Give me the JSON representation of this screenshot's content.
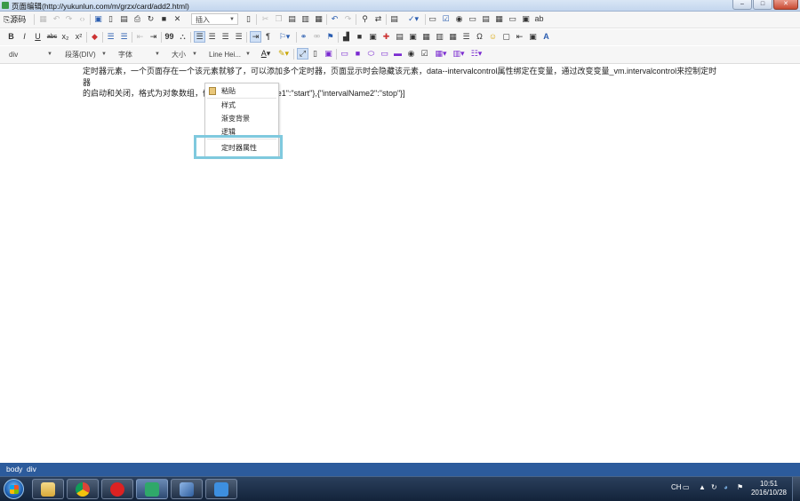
{
  "window": {
    "title": "页面编辑(http://yukunlun.com/m/grzx/card/add2.html)",
    "controls": [
      "–",
      "□",
      "✕"
    ]
  },
  "toolbar": {
    "source_label": "源码",
    "insert_label": "插入",
    "row2_glyphs": {
      "bold": "B",
      "italic": "I",
      "underline": "U",
      "strike": "abc",
      "subscript": "x₂",
      "superscript": "x²",
      "quote": "99",
      "special_char": "Ω"
    },
    "font_tag": "div",
    "paragraph_format": "段落(DIV)",
    "font_family": "字体",
    "font_size": "大小",
    "line_height": "Line Hei..."
  },
  "content": {
    "text_line1": "定时器元素，一个页面存在一个该元素就够了，可以添加多个定时器，页面显示时会隐藏该元素，data--intervalcontrol属性绑定在变量，通过改变变量_vm.intervalcontrol来控制定时器",
    "text_line2": "的启动和关闭，格式为对象数组，例如：[{\"intervalName1\":\"start\"},{\"intervalName2\":\"stop\"}]"
  },
  "context_menu": {
    "items": [
      "粘贴",
      "样式",
      "渐变背景",
      "逻辑",
      "定时器属性"
    ],
    "highlighted_item": "定时器属性"
  },
  "status_bar": {
    "path": [
      "body",
      "div"
    ]
  },
  "taskbar": {
    "apps": [
      "file-explorer",
      "chrome",
      "app-red",
      "app-green",
      "virtualbox",
      "app-blue"
    ],
    "tray_lang": "CH",
    "time": "10:51",
    "date": "2016/10/28"
  },
  "colors": {
    "statusbar": "#2c5b9c",
    "highlight_border": "#7fc9de",
    "taskbar": "#1b2c45"
  }
}
